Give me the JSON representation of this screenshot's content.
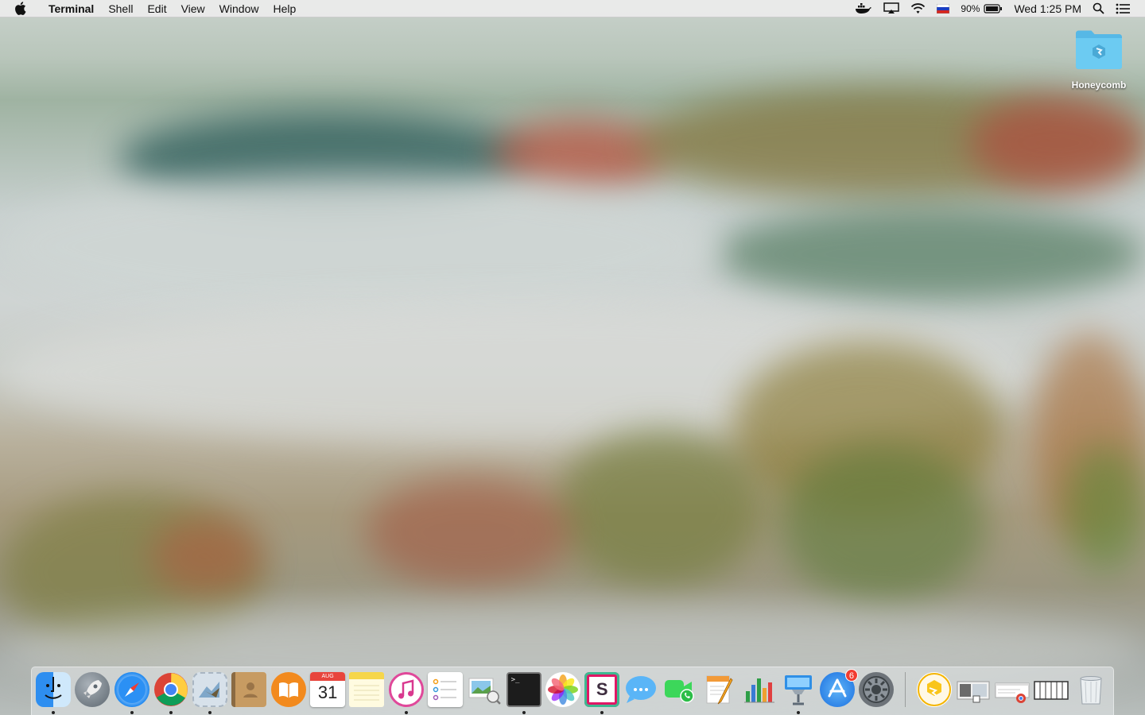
{
  "menubar": {
    "app_name": "Terminal",
    "menus": [
      "Shell",
      "Edit",
      "View",
      "Window",
      "Help"
    ],
    "status": {
      "battery_percent": "90%",
      "clock": "Wed 1:25 PM"
    }
  },
  "desktop": {
    "icons": [
      {
        "label": "Honeycomb",
        "icon": "folder-icon"
      }
    ]
  },
  "dock": {
    "apps": [
      {
        "name": "Finder",
        "running": true
      },
      {
        "name": "Launchpad",
        "running": false
      },
      {
        "name": "Safari",
        "running": true
      },
      {
        "name": "Google Chrome",
        "running": true
      },
      {
        "name": "Mail",
        "running": true
      },
      {
        "name": "Contacts",
        "running": false
      },
      {
        "name": "iBooks",
        "running": false
      },
      {
        "name": "Calendar",
        "running": false,
        "month": "AUG",
        "day": "31"
      },
      {
        "name": "Notes",
        "running": false
      },
      {
        "name": "iTunes",
        "running": true
      },
      {
        "name": "Reminders",
        "running": false
      },
      {
        "name": "Preview",
        "running": false
      },
      {
        "name": "Terminal",
        "running": true,
        "glyph": ">_"
      },
      {
        "name": "Photos",
        "running": false
      },
      {
        "name": "Slack",
        "running": true,
        "glyph": "S"
      },
      {
        "name": "Messages",
        "running": false
      },
      {
        "name": "FaceTime",
        "running": false
      },
      {
        "name": "Pages",
        "running": false
      },
      {
        "name": "Numbers",
        "running": false
      },
      {
        "name": "Keynote",
        "running": true
      },
      {
        "name": "App Store",
        "running": false,
        "badge": "6"
      },
      {
        "name": "System Preferences",
        "running": false
      }
    ],
    "docs": [
      {
        "name": "Honeycomb"
      },
      {
        "name": "Screenshot"
      },
      {
        "name": "Chrome window"
      },
      {
        "name": "Keyboard"
      },
      {
        "name": "Trash"
      }
    ]
  }
}
